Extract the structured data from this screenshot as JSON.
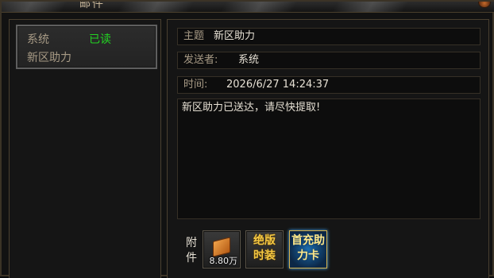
{
  "window": {
    "title": "邮件"
  },
  "mail_list": [
    {
      "sender": "系统",
      "status": "已读",
      "subject": "新区助力"
    }
  ],
  "detail": {
    "subject_label": "主题",
    "subject_value": "新区助力",
    "sender_label": "发送者:",
    "sender_value": "系统",
    "time_label": "时间:",
    "time_value": "2026/6/27 14:24:37",
    "body": "新区助力已送达，请尽快提取!"
  },
  "attachments": {
    "label": "附件",
    "items": [
      {
        "icon": "gold-ingot-book-icon",
        "quantity": "8.80万"
      },
      {
        "text": "绝版时装",
        "color": "#f5c842"
      },
      {
        "text": "首充助力卡",
        "color": "#ffe98a"
      }
    ]
  },
  "colors": {
    "read_status": "#22d322",
    "label_text": "#a89b86",
    "value_text": "#e6e0d4"
  }
}
